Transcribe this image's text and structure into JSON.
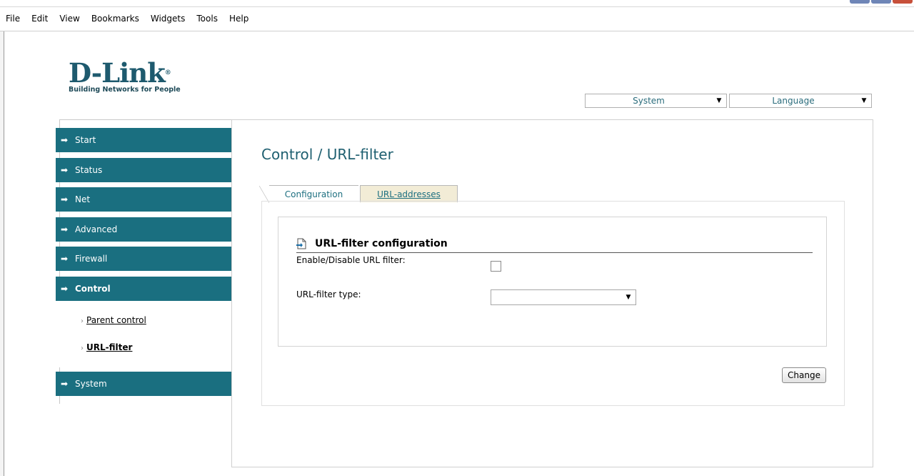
{
  "browser": {
    "menu": [
      "File",
      "Edit",
      "View",
      "Bookmarks",
      "Widgets",
      "Tools",
      "Help"
    ]
  },
  "logo": {
    "brand": "D-Link",
    "tagline": "Building Networks for People"
  },
  "top_selects": {
    "system": "System",
    "language": "Language"
  },
  "nav": {
    "items": [
      {
        "label": "Start"
      },
      {
        "label": "Status"
      },
      {
        "label": "Net"
      },
      {
        "label": "Advanced"
      },
      {
        "label": "Firewall"
      },
      {
        "label": "Control"
      },
      {
        "label": "System"
      }
    ],
    "sub_items": [
      {
        "label": "Parent control"
      },
      {
        "label": "URL-filter"
      }
    ]
  },
  "page": {
    "title": "Control / URL-filter",
    "tabs": [
      "Configuration",
      "URL-addresses"
    ],
    "section_title": "URL-filter configuration",
    "enable_label": "Enable/Disable URL filter:",
    "enable_checked": false,
    "type_label": "URL-filter type:",
    "type_value": "",
    "change_button": "Change"
  },
  "colors": {
    "nav_bg": "#1a6f80",
    "title": "#1e5f70",
    "tab_inactive_bg": "#f2ecd6"
  }
}
